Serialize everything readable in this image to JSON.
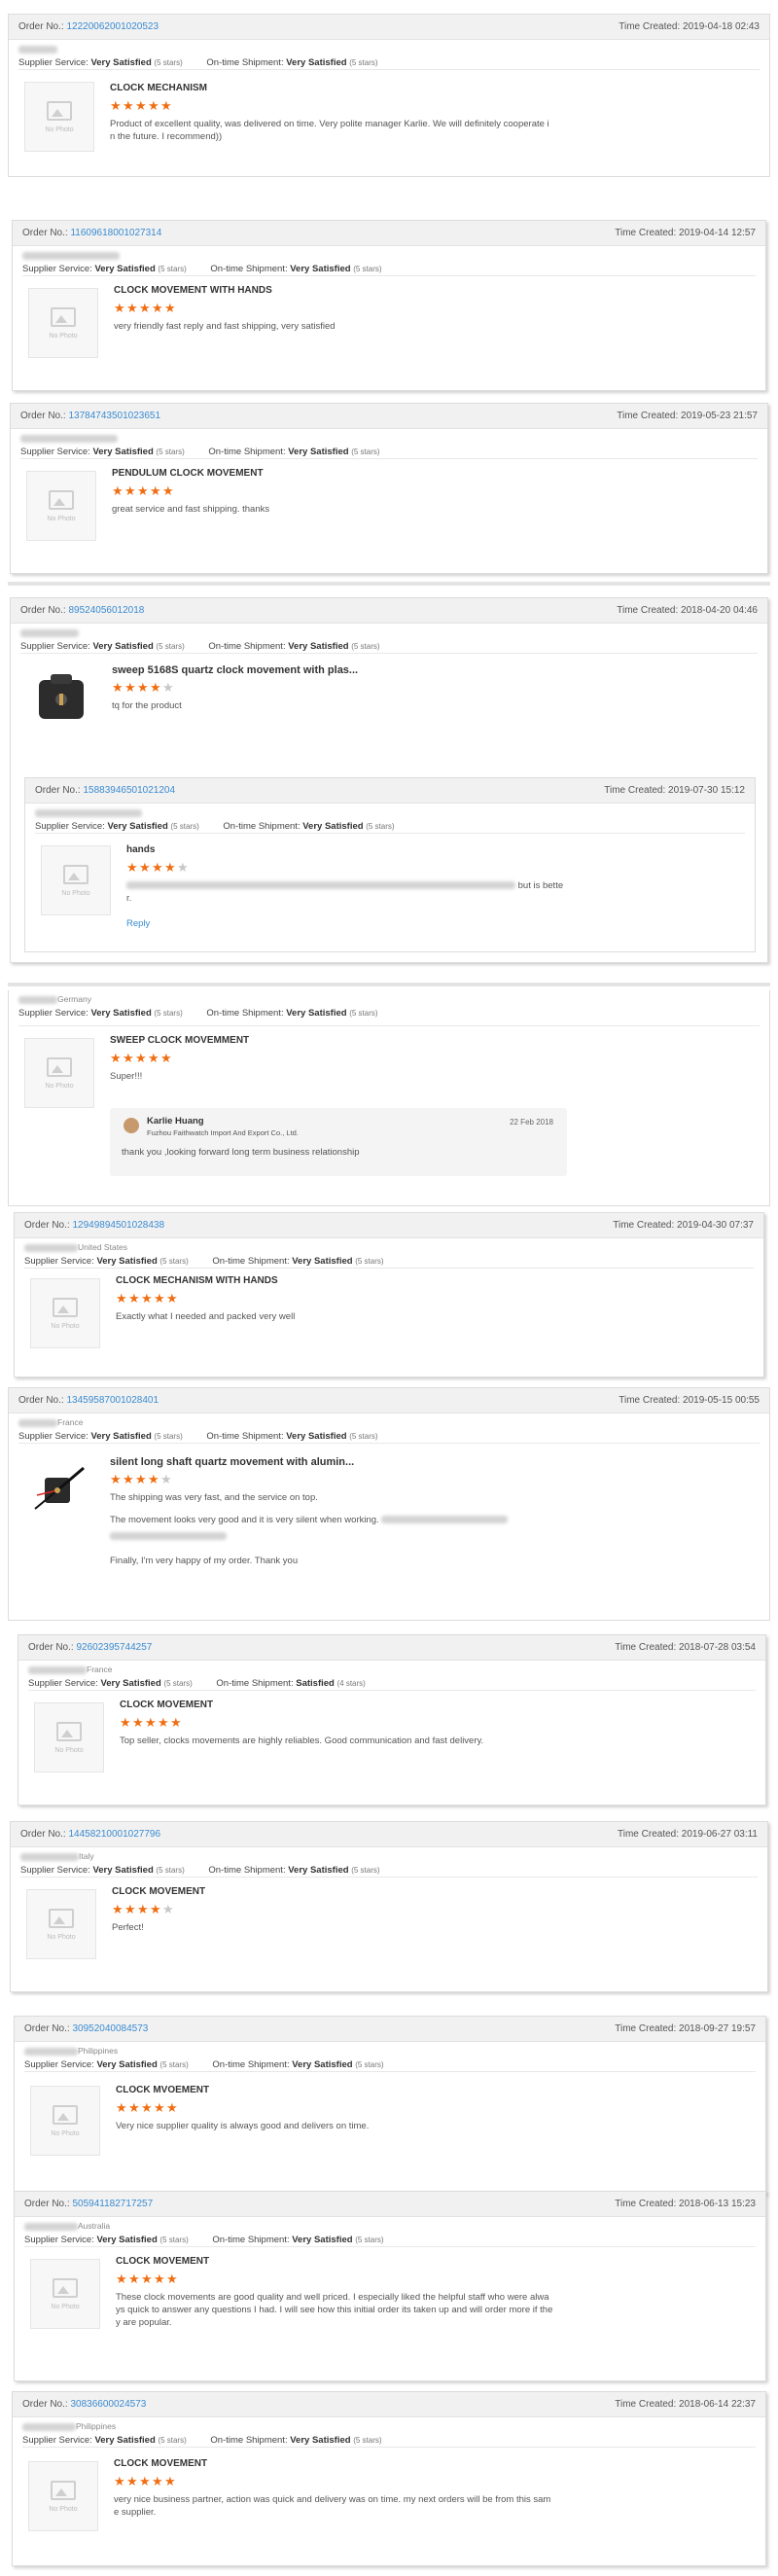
{
  "labels": {
    "order_no": "Order No.:",
    "time_created": "Time Created:",
    "supplier_service": "Supplier Service:",
    "ontime_shipment": "On-time Shipment:",
    "no_photo": "No Photo",
    "reply": "Reply"
  },
  "colors": {
    "star_on": "#f06e13",
    "star_off": "#c7c7c7",
    "link": "#3a8bd2"
  },
  "reviews": [
    {
      "order_no": "12220062001020523",
      "time": "2019-04-18 02:43",
      "country": "",
      "supplier": "Very Satisfied",
      "supplier_stars": "(5 stars)",
      "shipment": "Very Satisfied",
      "shipment_stars": "(5 stars)",
      "product": "CLOCK MECHANISM",
      "rating": 5,
      "feedback": "Product of excellent quality, was delivered on time. Very polite manager Karlie. We will definitely cooperate i",
      "feedback2": "n the future. I recommend))"
    },
    {
      "order_no": "11609618001027314",
      "time": "2019-04-14 12:57",
      "country": "",
      "supplier": "Very Satisfied",
      "supplier_stars": "(5 stars)",
      "shipment": "Very Satisfied",
      "shipment_stars": "(5 stars)",
      "product": "CLOCK MOVEMENT WITH HANDS",
      "rating": 5,
      "feedback": "very friendly fast reply and fast shipping, very satisfied"
    },
    {
      "order_no": "13784743501023651",
      "time": "2019-05-23 21:57",
      "country": "",
      "supplier": "Very Satisfied",
      "supplier_stars": "(5 stars)",
      "shipment": "Very Satisfied",
      "shipment_stars": "(5 stars)",
      "product": "PENDULUM CLOCK MOVEMENT",
      "rating": 5,
      "feedback": "great service and fast shipping. thanks"
    },
    {
      "order_no": "89524056012018",
      "time": "2018-04-20 04:46",
      "country": "",
      "supplier": "Very Satisfied",
      "supplier_stars": "(5 stars)",
      "shipment": "Very Satisfied",
      "shipment_stars": "(5 stars)",
      "product": "sweep 5168S quartz clock movement with plas...",
      "rating": 4,
      "feedback": "tq for the product"
    },
    {
      "order_no": "15883946501021204",
      "time": "2019-07-30 15:12",
      "country": "",
      "supplier": "Very Satisfied",
      "supplier_stars": "(5 stars)",
      "shipment": "Very Satisfied",
      "shipment_stars": "(5 stars)",
      "product": "hands",
      "rating": 4,
      "feedback": "but is bette",
      "feedback2": "r."
    },
    {
      "order_no": "",
      "time": "",
      "country": "Germany",
      "supplier": "Very Satisfied",
      "supplier_stars": "(5 stars)",
      "shipment": "Very Satisfied",
      "shipment_stars": "(5 stars)",
      "product": "SWEEP CLOCK MOVEMMENT",
      "rating": 5,
      "feedback": "Super!!!",
      "reply": {
        "name": "Karlie Huang",
        "company": "Fuzhou Faithwatch Import And Export Co., Ltd.",
        "date": "22 Feb 2018",
        "text": "thank you ,looking forward long term business relationship"
      }
    },
    {
      "order_no": "12949894501028438",
      "time": "2019-04-30 07:37",
      "country": "United States",
      "supplier": "Very Satisfied",
      "supplier_stars": "(5 stars)",
      "shipment": "Very Satisfied",
      "shipment_stars": "(5 stars)",
      "product": "CLOCK MECHANISM WITH HANDS",
      "rating": 5,
      "feedback": "Exactly what I needed and packed very well"
    },
    {
      "order_no": "13459587001028401",
      "time": "2019-05-15 00:55",
      "country": "France",
      "supplier": "Very Satisfied",
      "supplier_stars": "(5 stars)",
      "shipment": "Very Satisfied",
      "shipment_stars": "(5 stars)",
      "product": "silent long shaft quartz movement with alumin...",
      "rating": 4,
      "feedback": "The shipping was very fast, and the service on top.",
      "feedback2": "The movement looks very good and it is very silent when working.",
      "feedback3": "Finally, I'm very happy of my order. Thank you"
    },
    {
      "order_no": "92602395744257",
      "time": "2018-07-28 03:54",
      "country": "France",
      "supplier": "Very Satisfied",
      "supplier_stars": "(5 stars)",
      "shipment": "Satisfied",
      "shipment_stars": "(4 stars)",
      "product": "CLOCK MOVEMENT",
      "rating": 5,
      "feedback": "Top seller, clocks movements are highly reliables. Good communication and fast delivery."
    },
    {
      "order_no": "14458210001027796",
      "time": "2019-06-27 03:11",
      "country": "Italy",
      "supplier": "Very Satisfied",
      "supplier_stars": "(5 stars)",
      "shipment": "Very Satisfied",
      "shipment_stars": "(5 stars)",
      "product": "CLOCK MOVEMENT",
      "rating": 4,
      "feedback": "Perfect!"
    },
    {
      "order_no": "30952040084573",
      "time": "2018-09-27 19:57",
      "country": "Philippines",
      "supplier": "Very Satisfied",
      "supplier_stars": "(5 stars)",
      "shipment": "Very Satisfied",
      "shipment_stars": "(5 stars)",
      "product": "CLOCK MVOEMENT",
      "rating": 5,
      "feedback": "Very nice supplier quality is always good and delivers on time."
    },
    {
      "order_no": "505941182717257",
      "time": "2018-06-13 15:23",
      "country": "Australia",
      "supplier": "Very Satisfied",
      "supplier_stars": "(5 stars)",
      "shipment": "Very Satisfied",
      "shipment_stars": "(5 stars)",
      "product": "CLOCK MOVEMENT",
      "rating": 5,
      "feedback": "These clock movements are good quality and well priced. I especially liked the helpful staff who were alwa",
      "feedback2": "ys quick to answer any questions I had. I will see how this initial order its taken up and will order more if the",
      "feedback3": "y are popular."
    },
    {
      "order_no": "30836600024573",
      "time": "2018-06-14 22:37",
      "country": "Philippines",
      "supplier": "Very Satisfied",
      "supplier_stars": "(5 stars)",
      "shipment": "Very Satisfied",
      "shipment_stars": "(5 stars)",
      "product": "CLOCK MOVEMENT",
      "rating": 5,
      "feedback": "very nice business partner, action was quick and delivery was on time. my next orders will be from this sam",
      "feedback2": "e supplier."
    }
  ]
}
